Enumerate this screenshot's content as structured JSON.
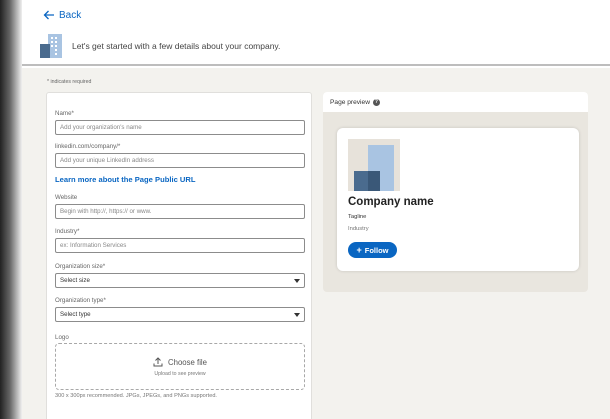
{
  "header": {
    "back_label": "Back",
    "intro_text": "Let's get started with a few details about your company."
  },
  "form": {
    "required_note": "* indicates required",
    "name": {
      "label": "Name*",
      "placeholder": "Add your organization's name"
    },
    "url": {
      "label": "linkedin.com/company/*",
      "placeholder": "Add your unique LinkedIn address"
    },
    "learn_more_link": "Learn more about the Page Public URL",
    "website": {
      "label": "Website",
      "placeholder": "Begin with http://, https:// or www."
    },
    "industry": {
      "label": "Industry*",
      "placeholder": "ex: Information Services"
    },
    "org_size": {
      "label": "Organization size*",
      "selected": "Select size"
    },
    "org_type": {
      "label": "Organization type*",
      "selected": "Select type"
    },
    "logo": {
      "label": "Logo",
      "choose_file": "Choose file",
      "upload_hint": "Upload to see preview",
      "size_note": "300 x 300px recommended. JPGs, JPEGs, and PNGs supported."
    }
  },
  "preview": {
    "title": "Page preview",
    "company_name": "Company name",
    "tagline": "Tagline",
    "industry": "Industry",
    "follow_label": "Follow"
  },
  "colors": {
    "accent": "#0a66c2",
    "background": "#f3f2ee",
    "logo_light": "#a9c4e2",
    "logo_dark": "#4a6b8e"
  }
}
